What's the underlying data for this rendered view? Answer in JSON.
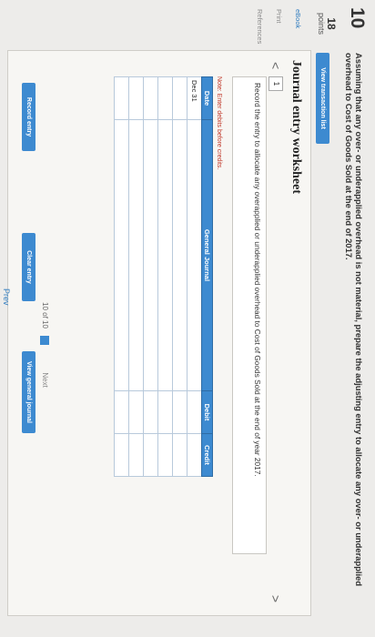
{
  "question": {
    "number": "10",
    "points_value": "18",
    "points_label": "points"
  },
  "references": {
    "ebook": "eBook",
    "print": "Print",
    "references": "References"
  },
  "prompt": "Assuming that any over- or underapplied overhead is not material, prepare the adjusting entry to allocate any over- or underapplied overhead to Cost of Goods Sold at the end of 2017.",
  "buttons": {
    "view_transaction_list": "View transaction list",
    "record_entry": "Record entry",
    "clear_entry": "Clear entry",
    "view_general_journal": "View general journal"
  },
  "worksheet": {
    "title": "Journal entry worksheet",
    "nav_left": "<",
    "nav_right": ">",
    "tab_number": "1",
    "instruction": "Record the entry to allocate any overapplied or underapplied overhead to Cost of Goods Sold at the end of year 2017.",
    "note": "Note: Enter debits before credits.",
    "headers": {
      "date": "Date",
      "general_journal": "General Journal",
      "debit": "Debit",
      "credit": "Credit"
    },
    "rows": [
      {
        "date": "Dec 31"
      },
      {
        "date": ""
      },
      {
        "date": ""
      },
      {
        "date": ""
      },
      {
        "date": ""
      },
      {
        "date": ""
      }
    ]
  },
  "pager": {
    "current": "10",
    "of": "of 10",
    "next": "Next",
    "prev": "Prev"
  },
  "colors": {
    "accent": "#3d8ad0",
    "note": "#c0392b"
  }
}
